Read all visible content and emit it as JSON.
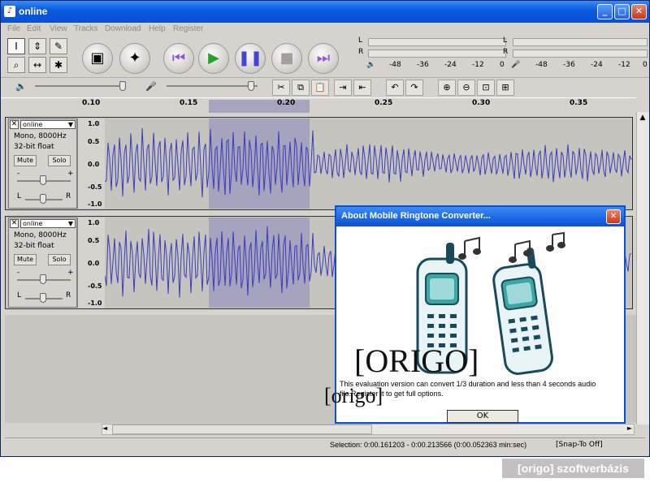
{
  "window": {
    "title": "online"
  },
  "menu": [
    "File",
    "Edit",
    "View",
    "Tracks",
    "Download",
    "Help",
    "Register"
  ],
  "transport": {
    "buttons": [
      "record-like",
      "reel",
      "skip-start",
      "play",
      "pause",
      "stop",
      "skip-end"
    ]
  },
  "meters": {
    "out": {
      "l": "L",
      "r": "R"
    },
    "in": {
      "l": "L",
      "r": "R"
    },
    "scale_left": [
      "-48",
      "-36",
      "-24",
      "-12",
      "0"
    ],
    "scale_right": [
      "-48",
      "-36",
      "-24",
      "-12",
      "0"
    ]
  },
  "ruler": {
    "ticks": [
      "0.10",
      "0.15",
      "0.20",
      "0.25",
      "0.30",
      "0.35"
    ]
  },
  "tracks": [
    {
      "name": "online",
      "format": "Mono, 8000Hz",
      "bits": "32-bit float",
      "mute": "Mute",
      "solo": "Solo",
      "minus": "-",
      "plus": "+",
      "left": "L",
      "right": "R",
      "scale": [
        "1.0",
        "0.5",
        "0.0",
        "-0.5",
        "-1.0"
      ]
    },
    {
      "name": "online",
      "format": "Mono, 8000Hz",
      "bits": "32-bit float",
      "mute": "Mute",
      "solo": "Solo",
      "minus": "-",
      "plus": "+",
      "left": "L",
      "right": "R",
      "scale": [
        "1.0",
        "0.5",
        "0.0",
        "-0.5",
        "-1.0"
      ]
    }
  ],
  "status": {
    "selection": "Selection: 0:00.161203 - 0:00.213566 (0:00.052363 min:sec)",
    "snap": "[Snap-To Off]"
  },
  "dialog": {
    "title": "About Mobile Ringtone Converter...",
    "message": "This evaluation version can convert 1/3 duration and less than 4 seconds audio file.Register it to get full options.",
    "ok": "OK"
  },
  "watermarks": {
    "big": "[ORIGO]",
    "small": "[origo]"
  },
  "badge": "[origo] szoftverbázis",
  "colors": {
    "wave": "#3a3db8",
    "selection": "#a5a3be",
    "titlebar": "#0a4fd4"
  }
}
